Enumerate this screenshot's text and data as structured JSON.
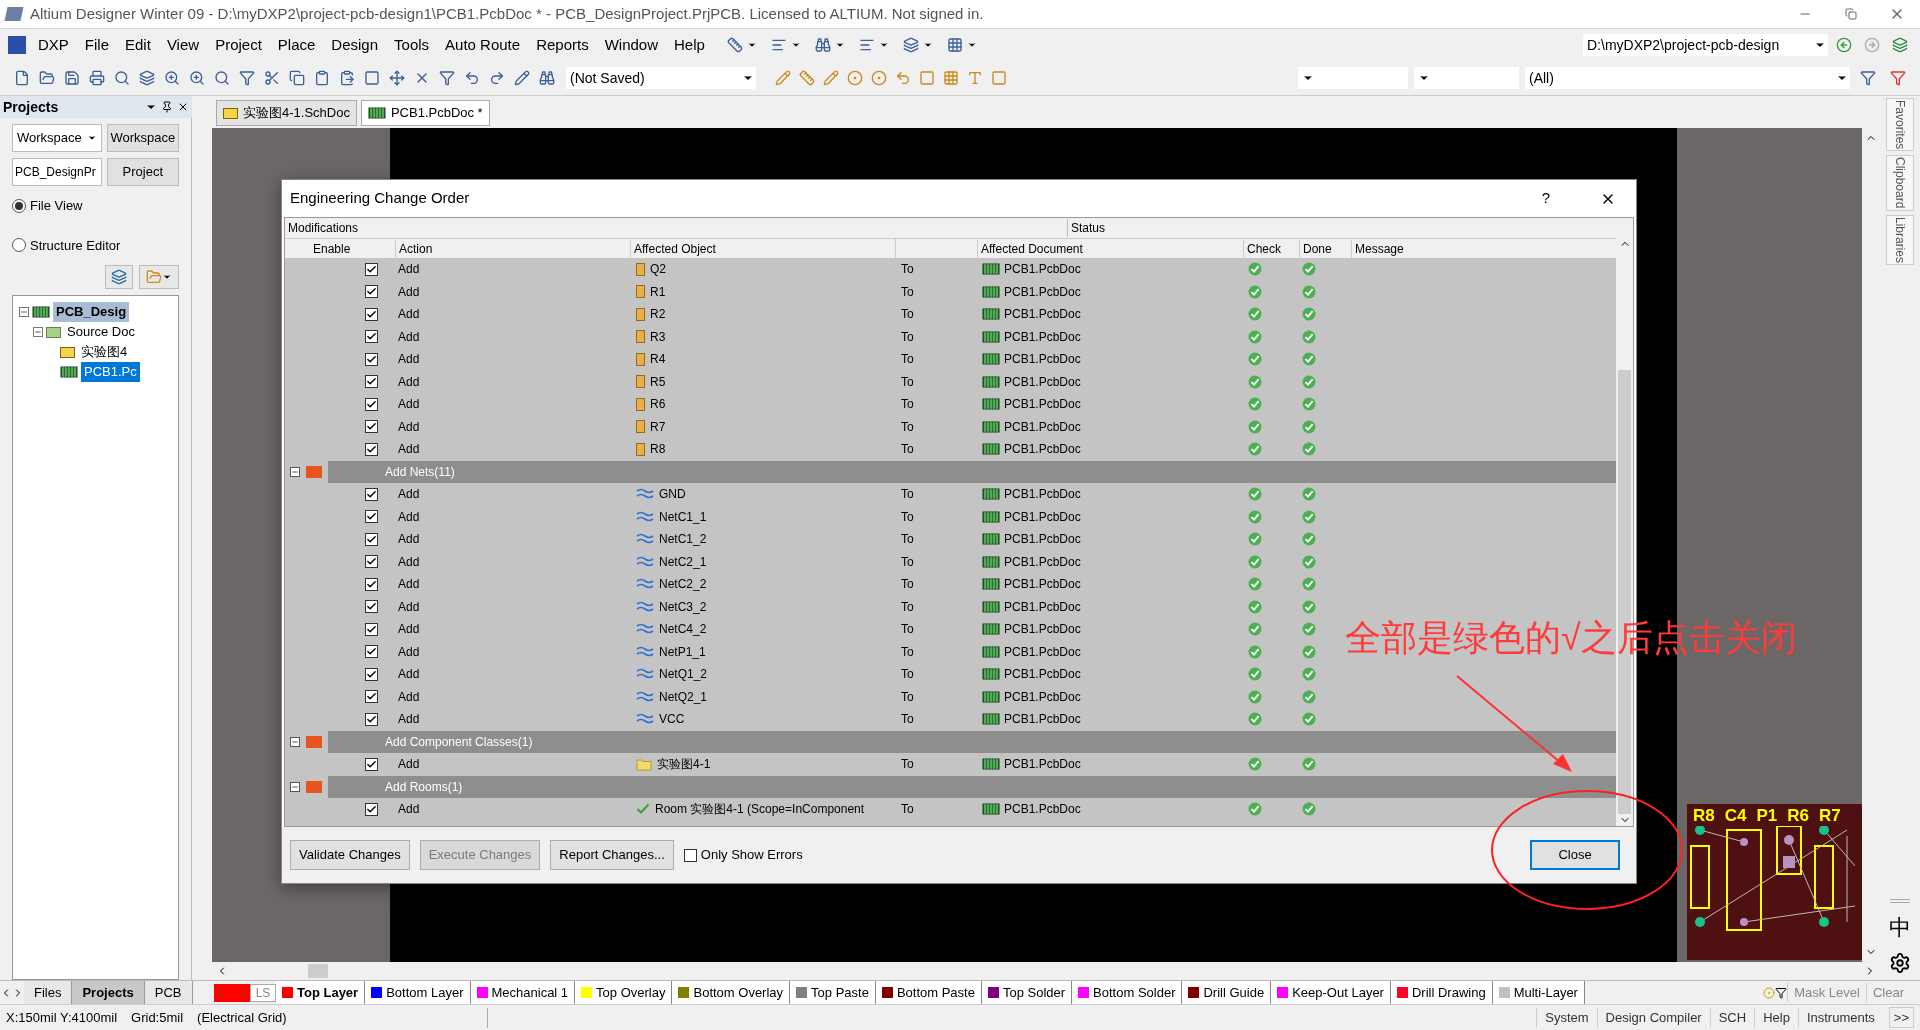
{
  "window": {
    "title": "Altium Designer Winter 09 - D:\\myDXP2\\project-pcb-design1\\PCB1.PcbDoc * - PCB_DesignProject.PrjPCB. Licensed to ALTIUM. Not signed in."
  },
  "menu": [
    "DXP",
    "File",
    "Edit",
    "View",
    "Project",
    "Place",
    "Design",
    "Tools",
    "Auto Route",
    "Reports",
    "Window",
    "Help"
  ],
  "toolbar": {
    "view_combo": "(Not Saved)",
    "path_combo": "D:\\myDXP2\\project-pcb-design",
    "filter_combo": "(All)"
  },
  "projects_panel": {
    "title": "Projects",
    "workspace_combo": "Workspace",
    "workspace_button": "Workspace",
    "project_field": "PCB_DesignPr",
    "project_button": "Project",
    "views": [
      {
        "label": "File View",
        "selected": true
      },
      {
        "label": "Structure Editor",
        "selected": false
      }
    ],
    "tree": [
      {
        "label": "PCB_Desig",
        "kind": "project",
        "selected": false,
        "expanded": true,
        "children": [
          {
            "label": "Source Doc",
            "kind": "folder",
            "selected": false,
            "expanded": true,
            "children": [
              {
                "label": "实验图4",
                "kind": "schematic",
                "selected": false
              },
              {
                "label": "PCB1.Pc",
                "kind": "pcb",
                "selected": true
              }
            ]
          }
        ]
      }
    ]
  },
  "document_tabs": [
    {
      "label": "实验图4-1.SchDoc",
      "kind": "schematic",
      "selected": false
    },
    {
      "label": "PCB1.PcbDoc *",
      "kind": "pcb",
      "selected": true
    }
  ],
  "dialog": {
    "title": "Engineering Change Order",
    "help": "?",
    "section_modifications": "Modifications",
    "section_status": "Status",
    "columns": {
      "enable": "Enable",
      "action": "Action",
      "affected_object": "Affected Object",
      "affected_document": "Affected Document",
      "check": "Check",
      "done": "Done",
      "message": "Message"
    },
    "rows": [
      {
        "kind": "item",
        "enabled": true,
        "action": "Add",
        "object": {
          "kind": "component",
          "label": "Q2"
        },
        "to": "To",
        "document": "PCB1.PcbDoc",
        "check": true,
        "done": true
      },
      {
        "kind": "item",
        "enabled": true,
        "action": "Add",
        "object": {
          "kind": "component",
          "label": "R1"
        },
        "to": "To",
        "document": "PCB1.PcbDoc",
        "check": true,
        "done": true
      },
      {
        "kind": "item",
        "enabled": true,
        "action": "Add",
        "object": {
          "kind": "component",
          "label": "R2"
        },
        "to": "To",
        "document": "PCB1.PcbDoc",
        "check": true,
        "done": true
      },
      {
        "kind": "item",
        "enabled": true,
        "action": "Add",
        "object": {
          "kind": "component",
          "label": "R3"
        },
        "to": "To",
        "document": "PCB1.PcbDoc",
        "check": true,
        "done": true
      },
      {
        "kind": "item",
        "enabled": true,
        "action": "Add",
        "object": {
          "kind": "component",
          "label": "R4"
        },
        "to": "To",
        "document": "PCB1.PcbDoc",
        "check": true,
        "done": true
      },
      {
        "kind": "item",
        "enabled": true,
        "action": "Add",
        "object": {
          "kind": "component",
          "label": "R5"
        },
        "to": "To",
        "document": "PCB1.PcbDoc",
        "check": true,
        "done": true
      },
      {
        "kind": "item",
        "enabled": true,
        "action": "Add",
        "object": {
          "kind": "component",
          "label": "R6"
        },
        "to": "To",
        "document": "PCB1.PcbDoc",
        "check": true,
        "done": true
      },
      {
        "kind": "item",
        "enabled": true,
        "action": "Add",
        "object": {
          "kind": "component",
          "label": "R7"
        },
        "to": "To",
        "document": "PCB1.PcbDoc",
        "check": true,
        "done": true
      },
      {
        "kind": "item",
        "enabled": true,
        "action": "Add",
        "object": {
          "kind": "component",
          "label": "R8"
        },
        "to": "To",
        "document": "PCB1.PcbDoc",
        "check": true,
        "done": true
      },
      {
        "kind": "group",
        "label": "Add Nets(11)",
        "expanded": true
      },
      {
        "kind": "item",
        "enabled": true,
        "action": "Add",
        "object": {
          "kind": "net",
          "label": "GND"
        },
        "to": "To",
        "document": "PCB1.PcbDoc",
        "check": true,
        "done": true
      },
      {
        "kind": "item",
        "enabled": true,
        "action": "Add",
        "object": {
          "kind": "net",
          "label": "NetC1_1"
        },
        "to": "To",
        "document": "PCB1.PcbDoc",
        "check": true,
        "done": true
      },
      {
        "kind": "item",
        "enabled": true,
        "action": "Add",
        "object": {
          "kind": "net",
          "label": "NetC1_2"
        },
        "to": "To",
        "document": "PCB1.PcbDoc",
        "check": true,
        "done": true
      },
      {
        "kind": "item",
        "enabled": true,
        "action": "Add",
        "object": {
          "kind": "net",
          "label": "NetC2_1"
        },
        "to": "To",
        "document": "PCB1.PcbDoc",
        "check": true,
        "done": true
      },
      {
        "kind": "item",
        "enabled": true,
        "action": "Add",
        "object": {
          "kind": "net",
          "label": "NetC2_2"
        },
        "to": "To",
        "document": "PCB1.PcbDoc",
        "check": true,
        "done": true
      },
      {
        "kind": "item",
        "enabled": true,
        "action": "Add",
        "object": {
          "kind": "net",
          "label": "NetC3_2"
        },
        "to": "To",
        "document": "PCB1.PcbDoc",
        "check": true,
        "done": true
      },
      {
        "kind": "item",
        "enabled": true,
        "action": "Add",
        "object": {
          "kind": "net",
          "label": "NetC4_2"
        },
        "to": "To",
        "document": "PCB1.PcbDoc",
        "check": true,
        "done": true
      },
      {
        "kind": "item",
        "enabled": true,
        "action": "Add",
        "object": {
          "kind": "net",
          "label": "NetP1_1"
        },
        "to": "To",
        "document": "PCB1.PcbDoc",
        "check": true,
        "done": true
      },
      {
        "kind": "item",
        "enabled": true,
        "action": "Add",
        "object": {
          "kind": "net",
          "label": "NetQ1_2"
        },
        "to": "To",
        "document": "PCB1.PcbDoc",
        "check": true,
        "done": true
      },
      {
        "kind": "item",
        "enabled": true,
        "action": "Add",
        "object": {
          "kind": "net",
          "label": "NetQ2_1"
        },
        "to": "To",
        "document": "PCB1.PcbDoc",
        "check": true,
        "done": true
      },
      {
        "kind": "item",
        "enabled": true,
        "action": "Add",
        "object": {
          "kind": "net",
          "label": "VCC"
        },
        "to": "To",
        "document": "PCB1.PcbDoc",
        "check": true,
        "done": true
      },
      {
        "kind": "group",
        "label": "Add Component Classes(1)",
        "expanded": true
      },
      {
        "kind": "item",
        "enabled": true,
        "action": "Add",
        "object": {
          "kind": "class",
          "label": "实验图4-1"
        },
        "to": "To",
        "document": "PCB1.PcbDoc",
        "check": true,
        "done": true
      },
      {
        "kind": "group",
        "label": "Add Rooms(1)",
        "expanded": true
      },
      {
        "kind": "item",
        "enabled": true,
        "action": "Add",
        "object": {
          "kind": "room",
          "label": "Room 实验图4-1 (Scope=InComponent"
        },
        "to": "To",
        "document": "PCB1.PcbDoc",
        "check": true,
        "done": true
      }
    ],
    "buttons": [
      {
        "label": "Validate Changes",
        "disabled": false
      },
      {
        "label": "Execute Changes",
        "disabled": true
      },
      {
        "label": "Report Changes...",
        "disabled": false
      }
    ],
    "only_show_errors": {
      "label": "Only Show Errors",
      "checked": false
    },
    "close": "Close"
  },
  "annotation": {
    "text": "全部是绿色的√之后点击关闭"
  },
  "board": {
    "labels": [
      "R8",
      "C4",
      "P1",
      "R6",
      "R7"
    ]
  },
  "right_panels": {
    "tabs": [
      "Favorites",
      "Clipboard",
      "Libraries"
    ],
    "ime": "中"
  },
  "panel_tabs": [
    {
      "label": "Files",
      "selected": false
    },
    {
      "label": "Projects",
      "selected": true
    },
    {
      "label": "PCB",
      "selected": false
    }
  ],
  "layer_bar": {
    "swatch": "LS",
    "mask_level": "Mask Level",
    "clear": "Clear",
    "layers": [
      {
        "label": "Top Layer",
        "color": "#ff0000",
        "selected": true
      },
      {
        "label": "Bottom Layer",
        "color": "#0000ff",
        "selected": false
      },
      {
        "label": "Mechanical 1",
        "color": "#ff00ff",
        "selected": false
      },
      {
        "label": "Top Overlay",
        "color": "#ffff00",
        "selected": false
      },
      {
        "label": "Bottom Overlay",
        "color": "#808000",
        "selected": false
      },
      {
        "label": "Top Paste",
        "color": "#808080",
        "selected": false
      },
      {
        "label": "Bottom Paste",
        "color": "#800000",
        "selected": false
      },
      {
        "label": "Top Solder",
        "color": "#800080",
        "selected": false
      },
      {
        "label": "Bottom Solder",
        "color": "#ff00ff",
        "selected": false
      },
      {
        "label": "Drill Guide",
        "color": "#800000",
        "selected": false
      },
      {
        "label": "Keep-Out Layer",
        "color": "#ff00ff",
        "selected": false
      },
      {
        "label": "Drill Drawing",
        "color": "#ff002a",
        "selected": false
      },
      {
        "label": "Multi-Layer",
        "color": "#c0c0c0",
        "selected": false
      }
    ]
  },
  "status_bar": {
    "coordinates": "X:150mil Y:4100mil",
    "grid": "Grid:5mil",
    "grid_mode": "(Electrical Grid)",
    "panels": [
      "System",
      "Design Compiler",
      "SCH",
      "Help",
      "Instruments"
    ],
    "more": ">>"
  }
}
